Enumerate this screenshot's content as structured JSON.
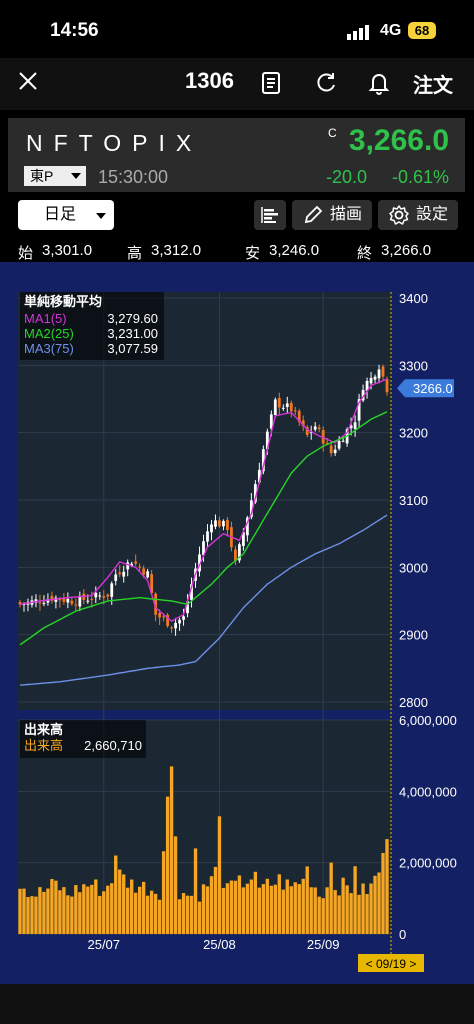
{
  "status_bar": {
    "time": "14:56",
    "network": "4G",
    "battery": "68"
  },
  "nav": {
    "code": "1306",
    "order_label": "注文"
  },
  "quote": {
    "name": "NFTOPIX",
    "market": "東P",
    "time": "15:30:00",
    "mark": "C",
    "price": "3,266.0",
    "change": "-20.0",
    "change_pct": "-0.61%"
  },
  "toolbar": {
    "period": "日足",
    "draw_label": "描画",
    "settings_label": "設定"
  },
  "ohlc": {
    "open_label": "始",
    "open": "3,301.0",
    "high_label": "高",
    "high": "3,312.0",
    "low_label": "安",
    "low": "3,246.0",
    "close_label": "終",
    "close": "3,266.0"
  },
  "indicator_legend": {
    "title": "単純移動平均",
    "items": [
      {
        "name": "MA1(5)",
        "value": "3,279.60",
        "color": "#d633d6"
      },
      {
        "name": "MA2(25)",
        "value": "3,231.00",
        "color": "#26d626"
      },
      {
        "name": "MA3(75)",
        "value": "3,077.59",
        "color": "#6f8fe8"
      }
    ]
  },
  "volume_legend": {
    "title": "出来高",
    "name": "出来高",
    "value": "2,660,710",
    "color": "#f5a623"
  },
  "current_price_label": "3266.0",
  "date_marker": "< 09/19 >",
  "colors": {
    "up": "#ffffff",
    "down": "#f07820",
    "bg": "#142064",
    "pane": "#1b2733",
    "price_green": "#2ec24a"
  },
  "chart_data": {
    "type": "candlestick",
    "price_axis": {
      "ylim": [
        2800,
        3400
      ],
      "ticks": [
        "3400",
        "3300",
        "3200",
        "3100",
        "3000",
        "2900",
        "2800"
      ]
    },
    "volume_axis": {
      "ylim": [
        0,
        6000000
      ],
      "ticks": [
        "6,000,000",
        "4,000,000",
        "2,000,000",
        "0"
      ]
    },
    "x_ticks": [
      "25/07",
      "25/08",
      "25/09"
    ],
    "candles_count": 93,
    "close_ref": [
      [
        0,
        2945
      ],
      [
        8,
        2955
      ],
      [
        14,
        2950
      ],
      [
        22,
        2960
      ],
      [
        24,
        2990
      ],
      [
        28,
        3010
      ],
      [
        32,
        2990
      ],
      [
        34,
        2930
      ],
      [
        38,
        2915
      ],
      [
        41,
        2925
      ],
      [
        43,
        2975
      ],
      [
        45,
        3020
      ],
      [
        48,
        3070
      ],
      [
        52,
        3060
      ],
      [
        54,
        3005
      ],
      [
        58,
        3100
      ],
      [
        61,
        3175
      ],
      [
        64,
        3245
      ],
      [
        68,
        3235
      ],
      [
        72,
        3195
      ],
      [
        74,
        3210
      ],
      [
        78,
        3170
      ],
      [
        81,
        3195
      ],
      [
        84,
        3220
      ],
      [
        86,
        3270
      ],
      [
        88,
        3280
      ],
      [
        90,
        3300
      ],
      [
        92,
        3266
      ]
    ],
    "ma5_ref": [
      [
        0,
        2945
      ],
      [
        5,
        2950
      ],
      [
        12,
        2955
      ],
      [
        18,
        2958
      ],
      [
        22,
        2985
      ],
      [
        25,
        3008
      ],
      [
        29,
        3000
      ],
      [
        32,
        2980
      ],
      [
        34,
        2940
      ],
      [
        38,
        2920
      ],
      [
        41,
        2930
      ],
      [
        44,
        2990
      ],
      [
        47,
        3030
      ],
      [
        51,
        3050
      ],
      [
        55,
        3040
      ],
      [
        58,
        3080
      ],
      [
        61,
        3150
      ],
      [
        64,
        3225
      ],
      [
        68,
        3230
      ],
      [
        72,
        3205
      ],
      [
        75,
        3195
      ],
      [
        79,
        3185
      ],
      [
        82,
        3200
      ],
      [
        85,
        3245
      ],
      [
        88,
        3270
      ],
      [
        92,
        3279.6
      ]
    ],
    "ma25_ref": [
      [
        0,
        2885
      ],
      [
        6,
        2910
      ],
      [
        14,
        2935
      ],
      [
        22,
        2950
      ],
      [
        30,
        2955
      ],
      [
        38,
        2950
      ],
      [
        42,
        2945
      ],
      [
        48,
        2975
      ],
      [
        52,
        3000
      ],
      [
        56,
        3020
      ],
      [
        60,
        3060
      ],
      [
        64,
        3100
      ],
      [
        68,
        3140
      ],
      [
        72,
        3165
      ],
      [
        76,
        3180
      ],
      [
        82,
        3195
      ],
      [
        88,
        3220
      ],
      [
        92,
        3231
      ]
    ],
    "ma75_ref": [
      [
        0,
        2825
      ],
      [
        10,
        2830
      ],
      [
        22,
        2840
      ],
      [
        32,
        2850
      ],
      [
        40,
        2855
      ],
      [
        44,
        2860
      ],
      [
        50,
        2895
      ],
      [
        56,
        2940
      ],
      [
        62,
        2975
      ],
      [
        68,
        3000
      ],
      [
        74,
        3020
      ],
      [
        80,
        3035
      ],
      [
        86,
        3055
      ],
      [
        92,
        3077.59
      ]
    ],
    "volume_ref": [
      [
        0,
        1.5
      ],
      [
        3,
        1.1
      ],
      [
        6,
        1.2
      ],
      [
        9,
        1.4
      ],
      [
        12,
        1.1
      ],
      [
        15,
        1.3
      ],
      [
        18,
        1.4
      ],
      [
        21,
        1.2
      ],
      [
        23,
        1.6
      ],
      [
        24,
        1.7
      ],
      [
        28,
        1.4
      ],
      [
        32,
        1.3
      ],
      [
        35,
        1.2
      ],
      [
        38,
        4.7
      ],
      [
        40,
        1.2
      ],
      [
        44,
        1.0
      ],
      [
        48,
        1.5
      ],
      [
        50,
        1.9
      ],
      [
        52,
        1.2
      ],
      [
        55,
        1.4
      ],
      [
        58,
        1.6
      ],
      [
        61,
        1.3
      ],
      [
        65,
        1.5
      ],
      [
        68,
        1.3
      ],
      [
        70,
        1.5
      ],
      [
        72,
        1.8
      ],
      [
        75,
        1.1
      ],
      [
        78,
        1.4
      ],
      [
        82,
        1.3
      ],
      [
        86,
        1.2
      ],
      [
        88,
        1.3
      ],
      [
        90,
        1.8
      ],
      [
        91,
        2.0
      ],
      [
        92,
        2.66
      ]
    ],
    "volume_spikes": [
      [
        24,
        2.2
      ],
      [
        38,
        4.7
      ],
      [
        44,
        2.4
      ],
      [
        50,
        3.3
      ],
      [
        53,
        1.5
      ],
      [
        60,
        1.3
      ],
      [
        70,
        1.4
      ],
      [
        78,
        2.0
      ],
      [
        84,
        1.9
      ]
    ]
  }
}
